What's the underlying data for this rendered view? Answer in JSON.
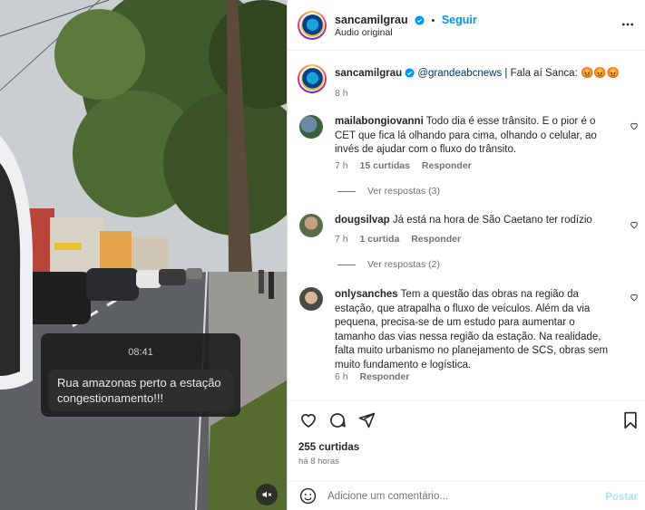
{
  "media": {
    "story_time": "08:41",
    "story_message": "Rua amazonas perto a estação\ncongestionamento!!!",
    "mute_icon": "speaker-muted-icon"
  },
  "header": {
    "username": "sancamilgrau",
    "follow_label": "Seguir",
    "separator": "•",
    "audio": "Áudio original"
  },
  "caption": {
    "username": "sancamilgrau",
    "mention": "@grandeabcnews",
    "text": " | Fala aí Sanca: 😡😡😡",
    "age": "8 h"
  },
  "comments": [
    {
      "username": "mailabongiovanni",
      "text": "Todo dia é esse trânsito. E o pior é o CET que fica lá olhando para cima, olhando o celular, ao invés de ajudar com o fluxo do trânsito.",
      "age": "7 h",
      "likes": "15 curtidas",
      "reply_label": "Responder",
      "view_replies": "Ver respostas (3)"
    },
    {
      "username": "dougsilvap",
      "text": "Já está na hora de São Caetano ter rodízio",
      "age": "7 h",
      "likes": "1 curtida",
      "reply_label": "Responder",
      "view_replies": "Ver respostas (2)"
    },
    {
      "username": "onlysanches",
      "text": "Tem a questão das obras na região da estação, que atrapalha o fluxo de veículos. Além da via pequena, precisa-se de um estudo para aumentar o tamanho das vias nessa região da estação. Na realidade, falta muito urbanismo no planejamento de SCS, obras sem muito fundamento e logística.",
      "age": "6 h",
      "reply_label": "Responder"
    }
  ],
  "actions": {
    "likes": "255 curtidas",
    "posted": "há 8 horas",
    "icons": [
      "heart-icon",
      "comment-icon",
      "share-icon",
      "bookmark-icon"
    ]
  },
  "compose": {
    "placeholder": "Adicione um comentário...",
    "post_label": "Postar"
  },
  "colors": {
    "link": "#0095f6",
    "verified": "#0095f6",
    "muted_text": "#737373",
    "post_disabled": "#b2dffc"
  }
}
